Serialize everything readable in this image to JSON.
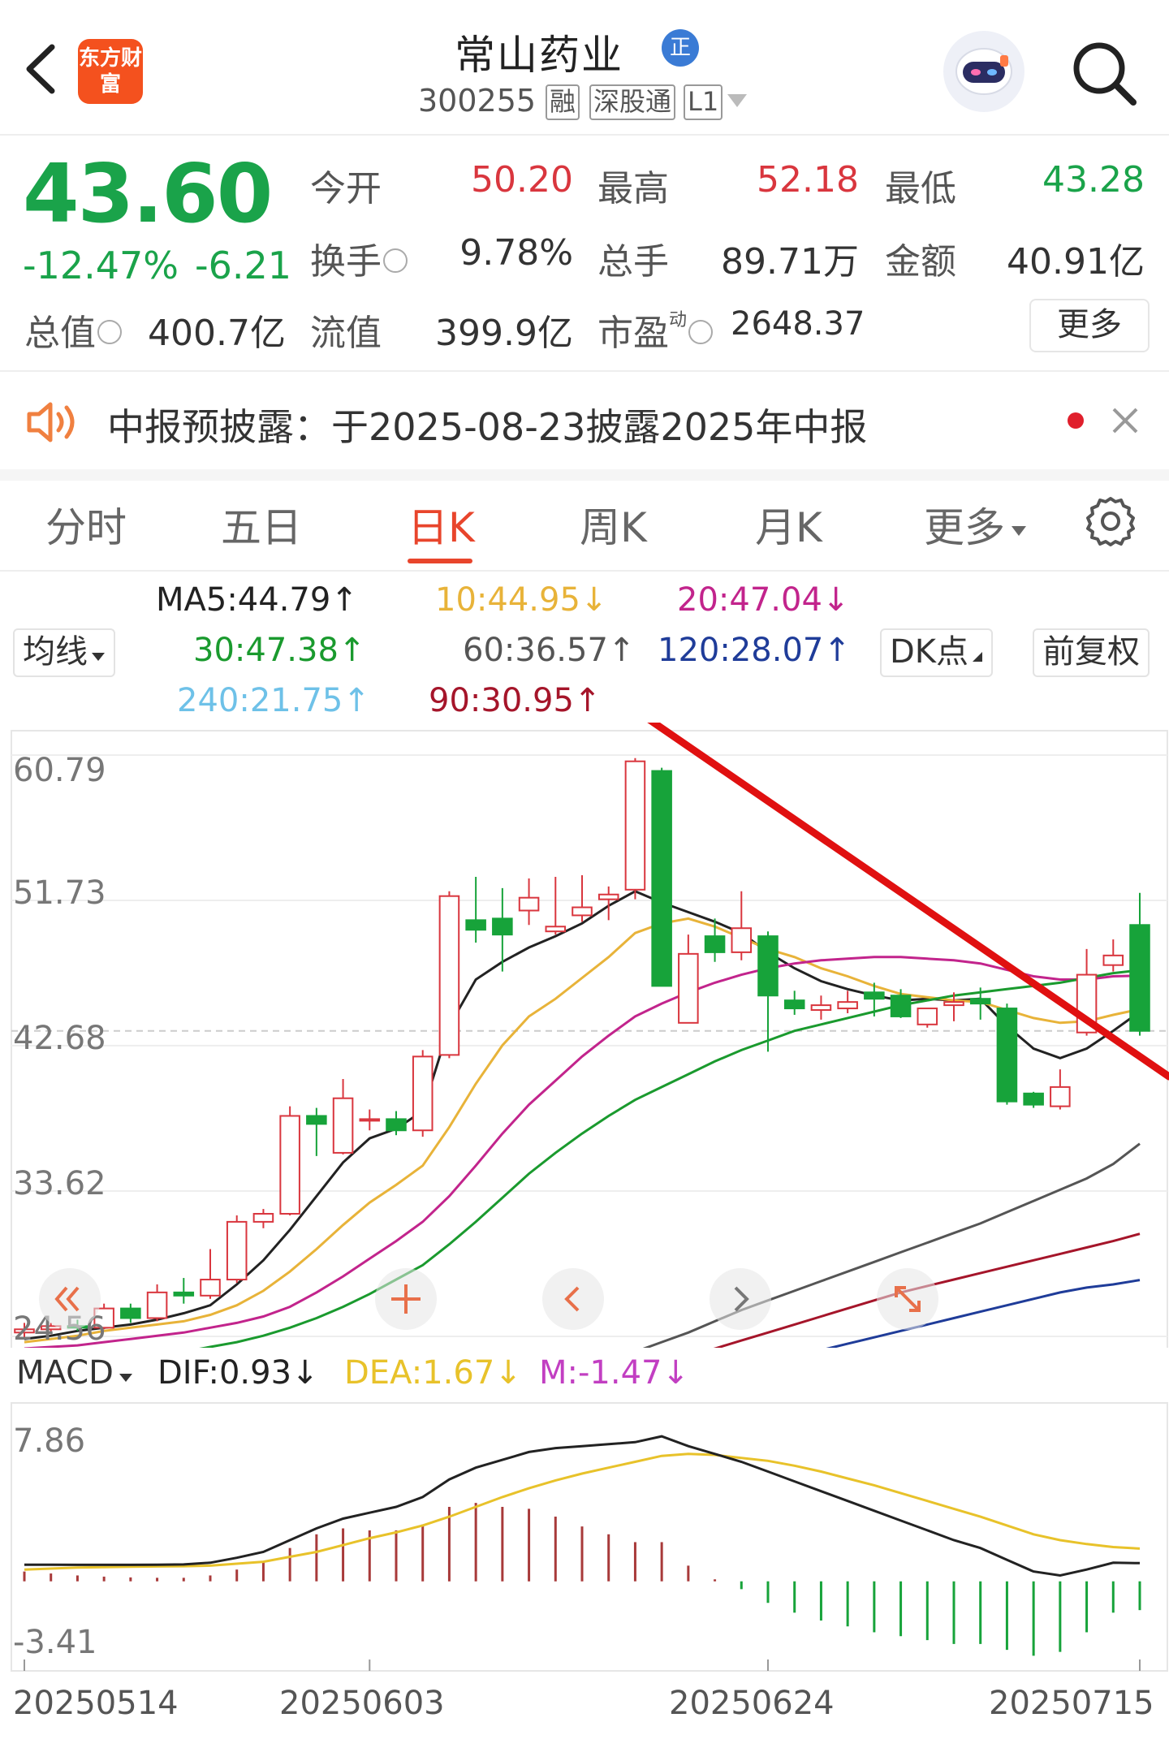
{
  "header": {
    "logo_text": "东方财富",
    "title": "常山药业",
    "badge": "正",
    "code": "300255",
    "tags": [
      "融",
      "深股通",
      "L1"
    ]
  },
  "quote": {
    "price": "43.60",
    "change_pct": "-12.47%",
    "change": "-6.21",
    "fields": [
      {
        "label": "今开",
        "value": "50.20"
      },
      {
        "label": "最高",
        "value": "52.18"
      },
      {
        "label": "最低",
        "value": "43.28"
      },
      {
        "label": "换手",
        "value": "9.78%"
      },
      {
        "label": "总手",
        "value": "89.71万"
      },
      {
        "label": "金额",
        "value": "40.91亿"
      },
      {
        "label": "总值",
        "value": "400.7亿"
      },
      {
        "label": "流值",
        "value": "399.9亿"
      },
      {
        "label": "市盈",
        "value": "2648.37"
      }
    ],
    "pe_superscript": "动",
    "more_label": "更多"
  },
  "notice": {
    "text": "中报预披露：于2025-08-23披露2025年中报"
  },
  "tabs": [
    "分时",
    "五日",
    "日K",
    "周K",
    "月K",
    "更多"
  ],
  "active_tab": "日K",
  "ma_legend": {
    "selector": "均线",
    "items": [
      {
        "text": "MA5:44.79↑",
        "color": "#222222"
      },
      {
        "text": "10:44.95↓",
        "color": "#e8b339"
      },
      {
        "text": "20:47.04↓",
        "color": "#c2248c"
      },
      {
        "text": "30:47.38↑",
        "color": "#1a9a2e"
      },
      {
        "text": "60:36.57↑",
        "color": "#555555"
      },
      {
        "text": "120:28.07↑",
        "color": "#1f3c99"
      },
      {
        "text": "240:21.75↑",
        "color": "#6ec1e8"
      },
      {
        "text": "90:30.95↑",
        "color": "#a5152a"
      }
    ],
    "dk_label": "DK点",
    "adjust_label": "前复权"
  },
  "kchart": {
    "y_ticks": [
      "60.79",
      "51.73",
      "42.68",
      "33.62",
      "24.56"
    ],
    "ylim": [
      24.56,
      60.79
    ],
    "overlay_buttons": [
      "rewind-icon",
      "plus-icon",
      "prev-icon",
      "next-icon",
      "expand-icon"
    ]
  },
  "chart_data": [
    {
      "type": "candlestick",
      "ylim": [
        24.56,
        60.79
      ],
      "x_labels": [
        "20250514",
        "20250603",
        "20250624",
        "20250715"
      ],
      "candles": [
        {
          "o": 24.8,
          "h": 25.4,
          "l": 24.5,
          "c": 25.0
        },
        {
          "o": 25.0,
          "h": 25.4,
          "l": 24.7,
          "c": 25.2
        },
        {
          "o": 25.2,
          "h": 25.6,
          "l": 24.9,
          "c": 25.1
        },
        {
          "o": 25.1,
          "h": 26.6,
          "l": 25.0,
          "c": 26.3
        },
        {
          "o": 26.3,
          "h": 26.6,
          "l": 25.4,
          "c": 25.7
        },
        {
          "o": 25.7,
          "h": 27.8,
          "l": 25.5,
          "c": 27.3
        },
        {
          "o": 27.3,
          "h": 28.2,
          "l": 26.6,
          "c": 27.1
        },
        {
          "o": 27.1,
          "h": 30.0,
          "l": 26.9,
          "c": 28.1
        },
        {
          "o": 28.1,
          "h": 32.1,
          "l": 27.9,
          "c": 31.7
        },
        {
          "o": 31.7,
          "h": 32.5,
          "l": 31.3,
          "c": 32.2
        },
        {
          "o": 32.2,
          "h": 38.9,
          "l": 32.1,
          "c": 38.3
        },
        {
          "o": 38.3,
          "h": 38.8,
          "l": 35.8,
          "c": 37.8
        },
        {
          "o": 36.0,
          "h": 40.6,
          "l": 35.9,
          "c": 39.4
        },
        {
          "o": 38.0,
          "h": 38.7,
          "l": 37.4,
          "c": 38.1
        },
        {
          "o": 38.1,
          "h": 38.6,
          "l": 37.1,
          "c": 37.4
        },
        {
          "o": 37.4,
          "h": 42.4,
          "l": 37.0,
          "c": 42.0
        },
        {
          "o": 42.1,
          "h": 52.3,
          "l": 41.9,
          "c": 52.0
        },
        {
          "o": 50.5,
          "h": 53.2,
          "l": 49.1,
          "c": 49.9
        },
        {
          "o": 50.6,
          "h": 52.5,
          "l": 47.3,
          "c": 49.6
        },
        {
          "o": 51.1,
          "h": 53.1,
          "l": 50.2,
          "c": 51.9
        },
        {
          "o": 49.8,
          "h": 53.2,
          "l": 49.6,
          "c": 50.1
        },
        {
          "o": 50.8,
          "h": 53.3,
          "l": 50.4,
          "c": 51.3
        },
        {
          "o": 51.8,
          "h": 52.6,
          "l": 50.5,
          "c": 52.1
        },
        {
          "o": 52.4,
          "h": 60.6,
          "l": 51.8,
          "c": 60.4
        },
        {
          "o": 59.8,
          "h": 60.0,
          "l": 46.4,
          "c": 46.4
        },
        {
          "o": 44.1,
          "h": 49.6,
          "l": 44.1,
          "c": 48.4
        },
        {
          "o": 49.5,
          "h": 50.6,
          "l": 47.9,
          "c": 48.5
        },
        {
          "o": 48.5,
          "h": 52.3,
          "l": 48.0,
          "c": 50.0
        },
        {
          "o": 49.5,
          "h": 49.8,
          "l": 42.3,
          "c": 45.8
        },
        {
          "o": 45.5,
          "h": 46.1,
          "l": 44.6,
          "c": 45.0
        },
        {
          "o": 44.9,
          "h": 45.8,
          "l": 44.3,
          "c": 45.2
        },
        {
          "o": 45.0,
          "h": 46.1,
          "l": 44.7,
          "c": 45.4
        },
        {
          "o": 46.0,
          "h": 46.6,
          "l": 44.5,
          "c": 45.6
        },
        {
          "o": 45.8,
          "h": 46.2,
          "l": 44.4,
          "c": 44.5
        },
        {
          "o": 44.0,
          "h": 44.5,
          "l": 43.8,
          "c": 45.0
        },
        {
          "o": 45.2,
          "h": 46.0,
          "l": 44.2,
          "c": 45.4
        },
        {
          "o": 45.6,
          "h": 46.3,
          "l": 44.3,
          "c": 45.3
        },
        {
          "o": 45.0,
          "h": 45.3,
          "l": 39.0,
          "c": 39.2
        },
        {
          "o": 39.7,
          "h": 39.8,
          "l": 38.8,
          "c": 39.0
        },
        {
          "o": 38.9,
          "h": 41.2,
          "l": 38.7,
          "c": 40.1
        },
        {
          "o": 43.5,
          "h": 48.7,
          "l": 43.3,
          "c": 47.1
        },
        {
          "o": 47.7,
          "h": 49.3,
          "l": 47.3,
          "c": 48.3
        },
        {
          "o": 50.2,
          "h": 52.2,
          "l": 43.3,
          "c": 43.6
        }
      ],
      "ma_series": [
        {
          "name": "MA5",
          "color": "#222222",
          "values": [
            24.4,
            24.6,
            24.9,
            25.1,
            25.3,
            25.6,
            26.0,
            26.5,
            27.8,
            29.3,
            31.2,
            33.3,
            35.4,
            36.9,
            37.5,
            38.6,
            43.9,
            46.8,
            47.9,
            48.8,
            49.5,
            50.3,
            51.4,
            52.3,
            51.6,
            51.0,
            50.4,
            49.7,
            48.5,
            47.5,
            46.7,
            46.2,
            45.8,
            45.5,
            45.6,
            45.5,
            45.6,
            43.9,
            42.5,
            41.9,
            42.5,
            43.6,
            44.79
          ]
        },
        {
          "name": "10",
          "color": "#e8b339",
          "values": [
            24.2,
            24.4,
            24.6,
            24.9,
            25.1,
            25.3,
            25.5,
            25.9,
            26.5,
            27.4,
            28.6,
            30.0,
            31.5,
            32.9,
            34.0,
            35.2,
            37.6,
            40.3,
            42.7,
            44.5,
            45.6,
            46.9,
            48.2,
            49.7,
            50.3,
            50.6,
            50.1,
            49.4,
            48.7,
            48.2,
            47.5,
            47.0,
            46.4,
            45.9,
            45.7,
            45.5,
            45.4,
            44.9,
            44.4,
            44.1,
            44.2,
            44.6,
            44.95
          ]
        },
        {
          "name": "20",
          "color": "#c2248c",
          "values": [
            23.8,
            23.9,
            24.0,
            24.2,
            24.4,
            24.6,
            24.8,
            25.1,
            25.4,
            25.8,
            26.4,
            27.3,
            28.3,
            29.4,
            30.5,
            31.7,
            33.3,
            35.2,
            37.2,
            39.0,
            40.5,
            42.0,
            43.3,
            44.5,
            45.3,
            46.0,
            46.6,
            47.1,
            47.5,
            47.8,
            48.0,
            48.1,
            48.2,
            48.2,
            48.1,
            48.0,
            47.8,
            47.4,
            47.0,
            46.8,
            46.8,
            47.0,
            47.04
          ]
        },
        {
          "name": "30",
          "color": "#1a9a2e",
          "values": [
            22.6,
            22.7,
            22.9,
            23.0,
            23.2,
            23.4,
            23.6,
            23.9,
            24.2,
            24.6,
            25.1,
            25.7,
            26.4,
            27.2,
            28.1,
            29.0,
            30.3,
            31.7,
            33.2,
            34.7,
            36.0,
            37.2,
            38.3,
            39.3,
            40.1,
            40.9,
            41.7,
            42.4,
            43.0,
            43.6,
            44.0,
            44.4,
            44.8,
            45.2,
            45.5,
            45.8,
            46.0,
            46.2,
            46.4,
            46.6,
            46.9,
            47.2,
            47.38
          ]
        },
        {
          "name": "60",
          "color": "#555555",
          "values": [
            null,
            null,
            null,
            null,
            null,
            null,
            null,
            null,
            null,
            null,
            null,
            null,
            null,
            null,
            null,
            null,
            null,
            null,
            null,
            null,
            22.2,
            22.6,
            23.1,
            23.6,
            24.2,
            24.8,
            25.5,
            26.2,
            26.8,
            27.4,
            28.0,
            28.6,
            29.2,
            29.8,
            30.4,
            31.0,
            31.6,
            32.3,
            33.0,
            33.7,
            34.4,
            35.3,
            36.57
          ]
        },
        {
          "name": "90",
          "color": "#a5152a",
          "values": [
            null,
            null,
            null,
            null,
            null,
            null,
            null,
            null,
            null,
            null,
            null,
            null,
            null,
            null,
            null,
            null,
            null,
            null,
            null,
            null,
            null,
            null,
            null,
            22.4,
            22.8,
            23.3,
            23.8,
            24.3,
            24.8,
            25.3,
            25.8,
            26.3,
            26.8,
            27.3,
            27.7,
            28.1,
            28.5,
            28.9,
            29.3,
            29.7,
            30.1,
            30.5,
            30.95
          ]
        },
        {
          "name": "120",
          "color": "#1f3c99",
          "values": [
            null,
            null,
            null,
            null,
            null,
            null,
            null,
            null,
            null,
            null,
            null,
            null,
            null,
            null,
            null,
            null,
            null,
            null,
            null,
            null,
            null,
            null,
            null,
            null,
            null,
            null,
            null,
            22.5,
            22.9,
            23.3,
            23.7,
            24.1,
            24.5,
            24.9,
            25.3,
            25.7,
            26.1,
            26.5,
            26.9,
            27.3,
            27.6,
            27.8,
            28.07
          ]
        }
      ],
      "last_price": 43.6
    },
    {
      "type": "macd",
      "ylim": [
        -3.41,
        7.86
      ],
      "dif": [
        0.85,
        0.85,
        0.84,
        0.84,
        0.84,
        0.85,
        0.86,
        0.95,
        1.2,
        1.5,
        2.1,
        2.7,
        3.2,
        3.5,
        3.8,
        4.3,
        5.2,
        5.8,
        6.2,
        6.6,
        6.8,
        6.9,
        7.0,
        7.1,
        7.4,
        6.9,
        6.5,
        6.1,
        5.6,
        5.1,
        4.6,
        4.1,
        3.6,
        3.1,
        2.6,
        2.1,
        1.7,
        1.1,
        0.5,
        0.3,
        0.6,
        0.95,
        0.93
      ],
      "dea": [
        0.6,
        0.65,
        0.7,
        0.72,
        0.74,
        0.76,
        0.77,
        0.8,
        0.9,
        1.0,
        1.25,
        1.5,
        1.85,
        2.2,
        2.5,
        2.85,
        3.3,
        3.8,
        4.3,
        4.75,
        5.15,
        5.5,
        5.8,
        6.1,
        6.4,
        6.5,
        6.45,
        6.3,
        6.15,
        5.9,
        5.6,
        5.25,
        4.9,
        4.5,
        4.1,
        3.7,
        3.3,
        2.85,
        2.4,
        2.1,
        1.9,
        1.75,
        1.67
      ],
      "macd": [
        0.5,
        0.4,
        0.3,
        0.24,
        0.2,
        0.18,
        0.18,
        0.3,
        0.6,
        1.0,
        1.7,
        2.4,
        2.7,
        2.6,
        2.6,
        2.9,
        3.8,
        4.0,
        3.8,
        3.7,
        3.3,
        2.8,
        2.4,
        2.0,
        2.0,
        0.8,
        0.1,
        -0.4,
        -1.1,
        -1.6,
        -2.0,
        -2.3,
        -2.6,
        -2.8,
        -3.0,
        -3.2,
        -3.2,
        -3.5,
        -3.8,
        -3.6,
        -2.6,
        -1.6,
        -1.47
      ],
      "dif_label": "DIF:0.93↓",
      "dea_label": "DEA:1.67↓",
      "m_label": "M:-1.47↓",
      "selector": "MACD",
      "y_ticks": [
        "7.86",
        "-3.41"
      ],
      "x_labels": [
        "20250514",
        "20250603",
        "20250624",
        "20250715"
      ]
    }
  ],
  "colors": {
    "up": "#d9363e",
    "down": "#17a33a",
    "accent": "#e8452c",
    "trendline": "#e01010"
  }
}
